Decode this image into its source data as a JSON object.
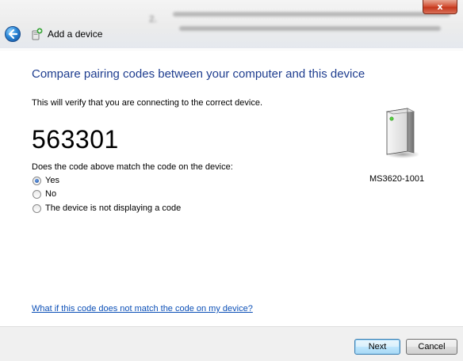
{
  "window": {
    "title": "Add a device",
    "close_label": "x",
    "background_text": {
      "step_number": "2."
    }
  },
  "main": {
    "heading": "Compare pairing codes between your computer and this device",
    "description": "This will verify that you are connecting to the correct device.",
    "pairing_code": "563301",
    "question": "Does the code above match the code on the device:",
    "options": [
      {
        "label": "Yes",
        "checked": true
      },
      {
        "label": "No",
        "checked": false
      },
      {
        "label": "The device is not displaying a code",
        "checked": false
      }
    ],
    "help_link": "What if this code does not match the code on my device?"
  },
  "device": {
    "name": "MS3620-1001",
    "icon": "device-icon"
  },
  "footer": {
    "next_label": "Next",
    "cancel_label": "Cancel"
  },
  "colors": {
    "heading": "#1e3d8f",
    "link": "#0b4fb7",
    "close_button": "#c5381d"
  }
}
